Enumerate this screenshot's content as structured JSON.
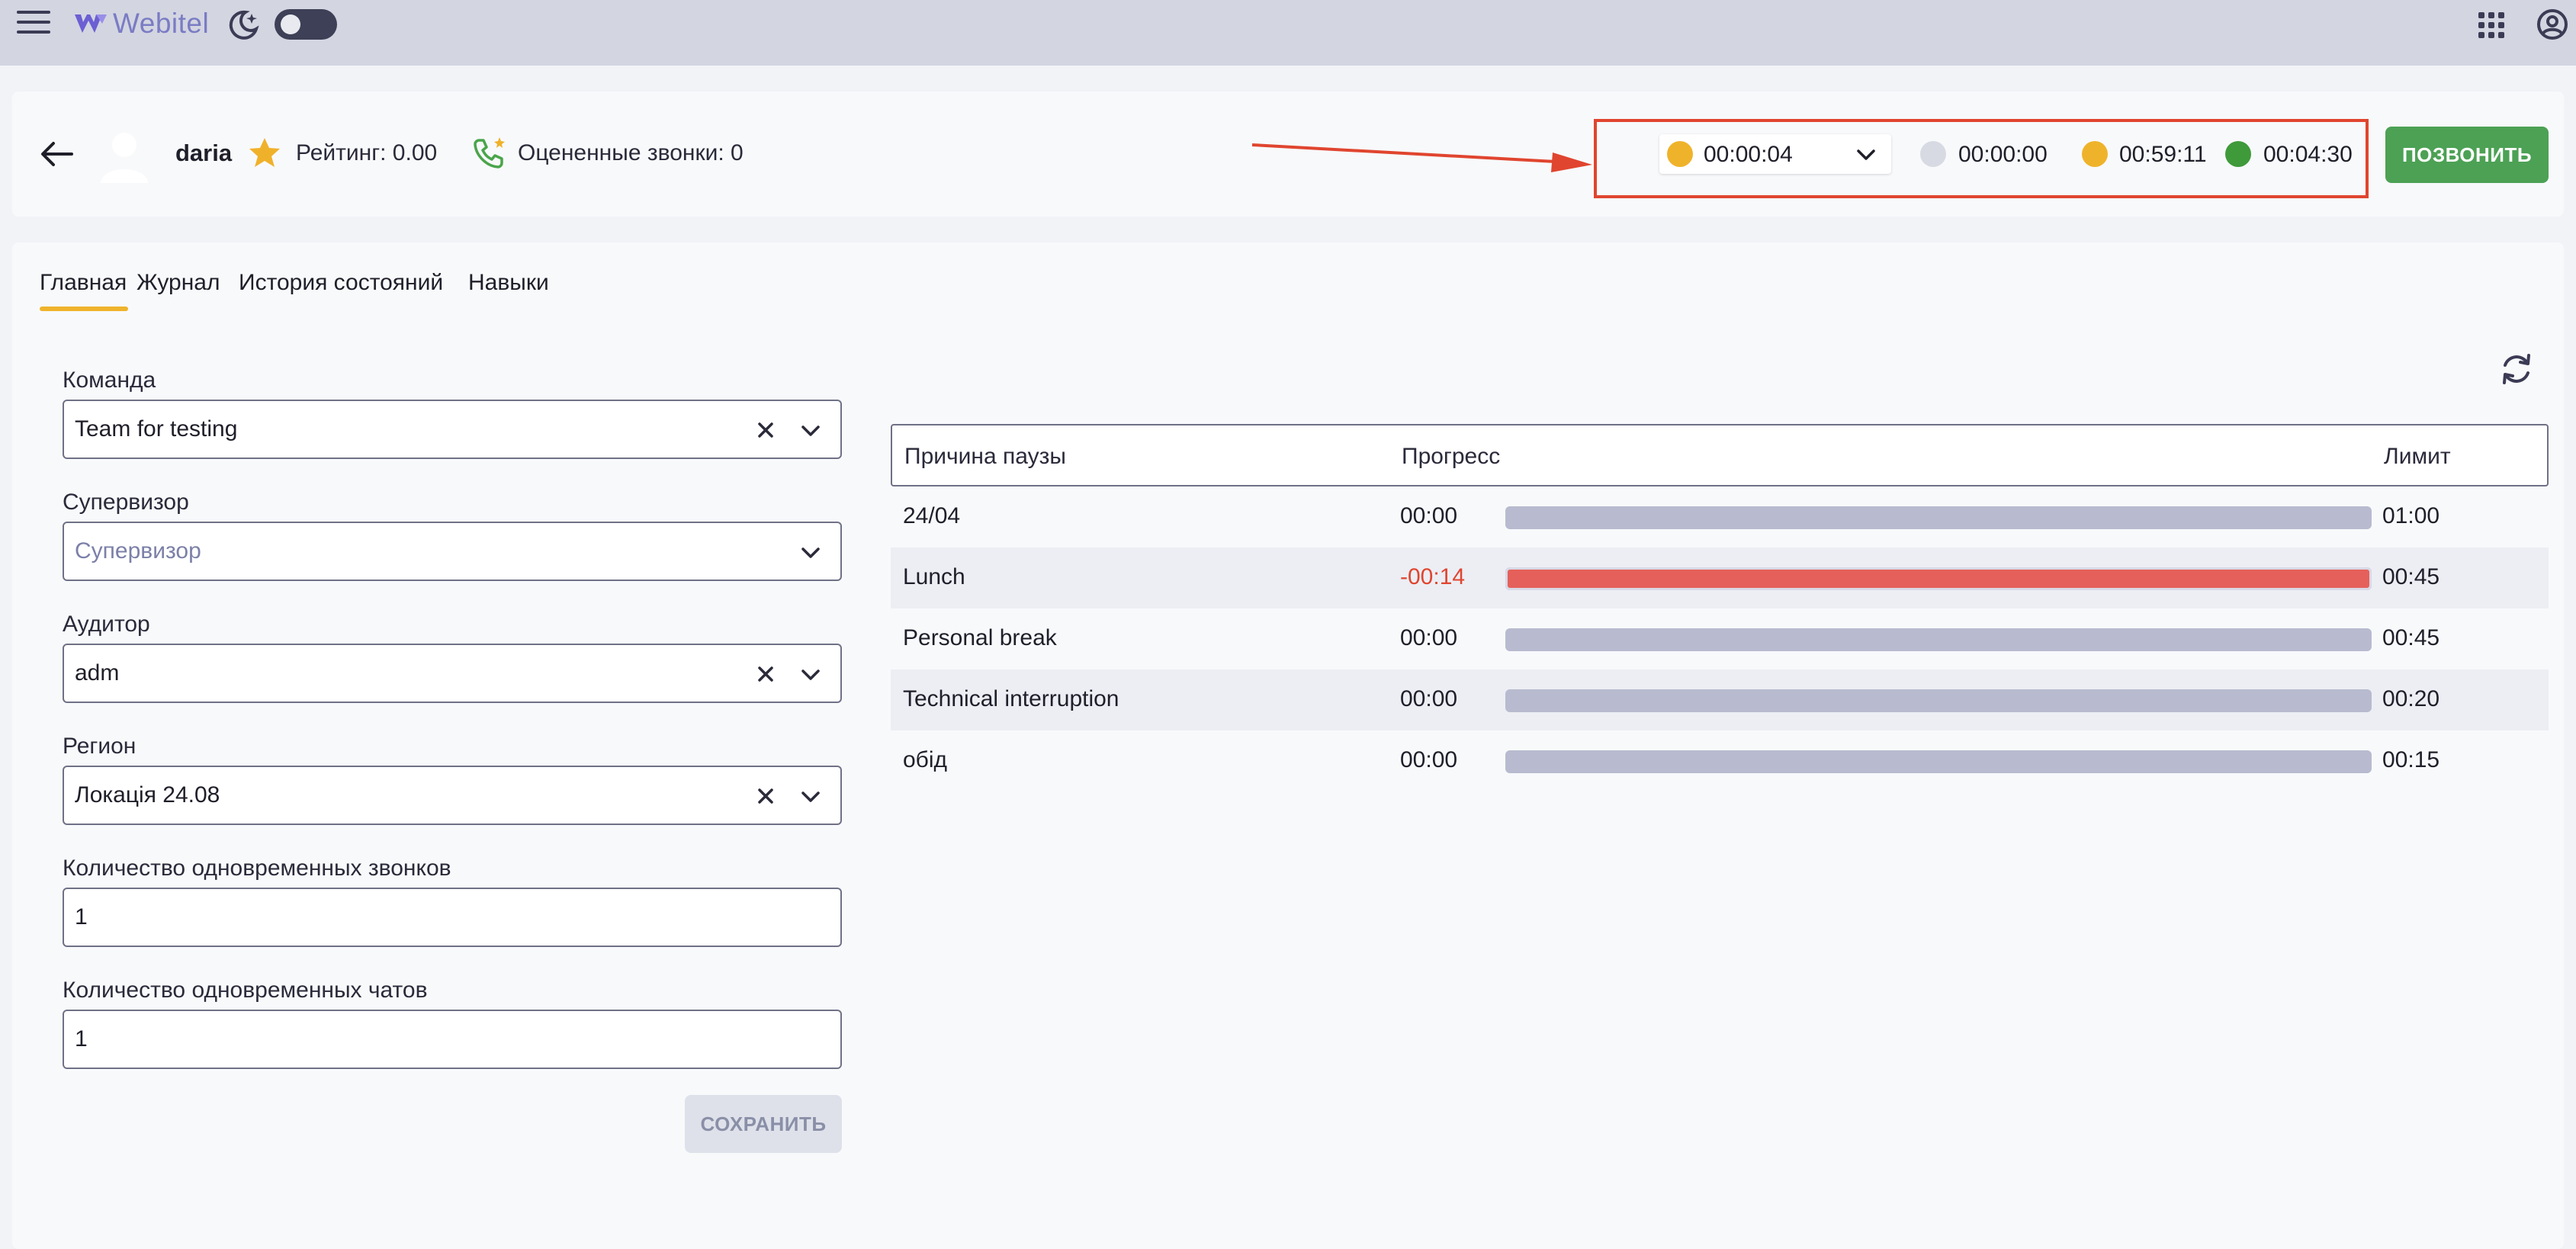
{
  "app": {
    "brand": "Webitel",
    "theme_toggle": "off",
    "icons": [
      "menu-icon",
      "webitel-logo",
      "moon-icon",
      "apps-grid-icon",
      "account-icon"
    ]
  },
  "agent": {
    "name": "daria",
    "rating_label": "Рейтинг: 0.00",
    "rated_calls_label": "Оцененные звонки: 0"
  },
  "status_bar": {
    "current_status": {
      "time": "00:00:04",
      "color": "#efb32b"
    },
    "timers": [
      {
        "time": "00:00:00",
        "color": "#d8dae3"
      },
      {
        "time": "00:59:11",
        "color": "#efb32b"
      },
      {
        "time": "00:04:30",
        "color": "#3f9a3a"
      }
    ],
    "call_button": "ПОЗВОНИТЬ",
    "annotation_color": "#e0452f"
  },
  "tabs": [
    {
      "label": "Главная",
      "active": true
    },
    {
      "label": "Журнал",
      "active": false
    },
    {
      "label": "История состояний",
      "active": false
    },
    {
      "label": "Навыки",
      "active": false
    }
  ],
  "form": {
    "team": {
      "label": "Команда",
      "value": "Team for testing"
    },
    "supervisor": {
      "label": "Супервизор",
      "placeholder": "Супервизор"
    },
    "auditor": {
      "label": "Аудитор",
      "value": "adm"
    },
    "region": {
      "label": "Регион",
      "value": "Локація 24.08"
    },
    "concurrent_calls": {
      "label": "Количество одновременных звонков",
      "value": "1"
    },
    "concurrent_chats": {
      "label": "Количество одновременных чатов",
      "value": "1"
    },
    "save_button": "СОХРАНИТЬ"
  },
  "pause_table": {
    "headers": {
      "reason": "Причина паузы",
      "progress": "Прогресс",
      "limit": "Лимит"
    },
    "rows": [
      {
        "reason": "24/04",
        "progress": "00:00",
        "limit": "01:00",
        "fill": 0,
        "over": false
      },
      {
        "reason": "Lunch",
        "progress": "-00:14",
        "limit": "00:45",
        "fill": 1,
        "over": true
      },
      {
        "reason": "Personal break",
        "progress": "00:00",
        "limit": "00:45",
        "fill": 0,
        "over": false
      },
      {
        "reason": "Technical interruption",
        "progress": "00:00",
        "limit": "00:20",
        "fill": 0,
        "over": false
      },
      {
        "reason": "обід",
        "progress": "00:00",
        "limit": "00:15",
        "fill": 0,
        "over": false
      }
    ],
    "colors": {
      "track": "#b8bbcf",
      "over": "#e5605a",
      "normal": "#8f93b0"
    }
  }
}
